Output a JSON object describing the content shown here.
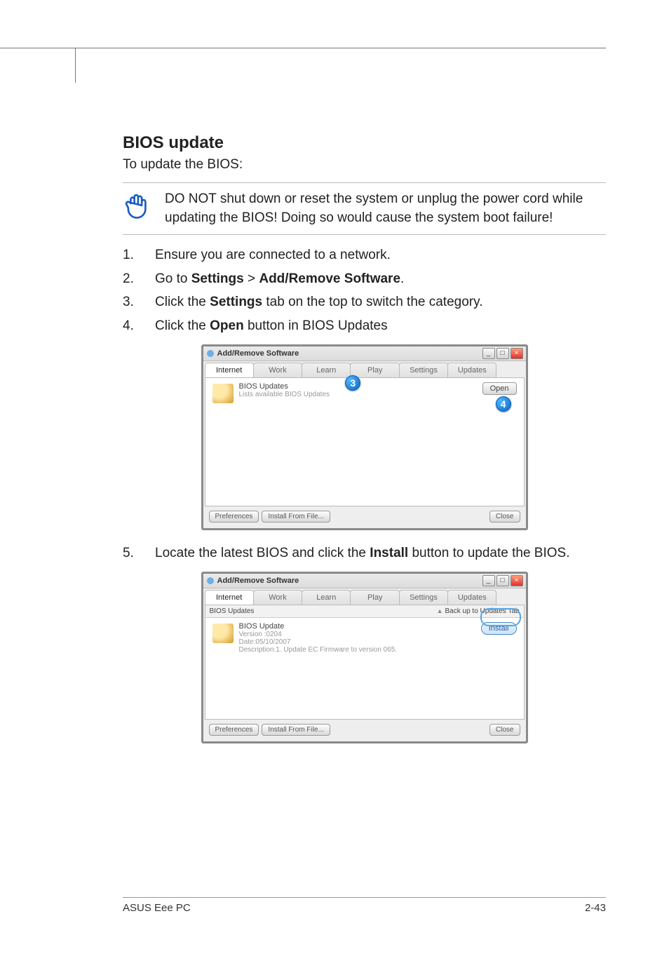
{
  "section_title": "BIOS update",
  "intro": "To update the BIOS:",
  "warning": "DO NOT shut down or reset the system or unplug the power cord while updating the BIOS! Doing so would cause the system boot failure!",
  "steps": {
    "s1": {
      "num": "1.",
      "text": "Ensure you are connected to a network."
    },
    "s2": {
      "num": "2.",
      "pre": "Go to ",
      "b1": "Settings",
      "mid": " > ",
      "b2": "Add/Remove Software",
      "post": "."
    },
    "s3": {
      "num": "3.",
      "pre": "Click the ",
      "b1": "Settings",
      "post": " tab on the top to switch the category."
    },
    "s4": {
      "num": "4.",
      "pre": "Click the ",
      "b1": "Open",
      "post": " button in BIOS Updates"
    },
    "s5": {
      "num": "5.",
      "pre": "Locate the latest BIOS and click the ",
      "b1": "Install",
      "post": " button to update the BIOS."
    }
  },
  "window": {
    "title": "Add/Remove Software",
    "tabs": [
      "Internet",
      "Work",
      "Learn",
      "Play",
      "Settings",
      "Updates"
    ]
  },
  "shot1": {
    "item_title": "BIOS Updates",
    "item_desc": "Lists available BIOS Updates",
    "open_btn": "Open",
    "callout3": "3",
    "callout4": "4",
    "prefs": "Preferences",
    "install_file": "Install From File...",
    "close": "Close"
  },
  "shot2": {
    "subbar_left": "BIOS Updates",
    "subbar_right": "Back up to Updates Tab",
    "item_title": "BIOS Update",
    "item_version": "Version :0204",
    "item_date": "Date:05/10/2007",
    "item_desc": "Description:1. Update EC Firmware to version 065.",
    "install_btn": "Install",
    "prefs": "Preferences",
    "install_file": "Install From File...",
    "close": "Close"
  },
  "footer": {
    "left": "ASUS Eee PC",
    "right": "2-43"
  }
}
